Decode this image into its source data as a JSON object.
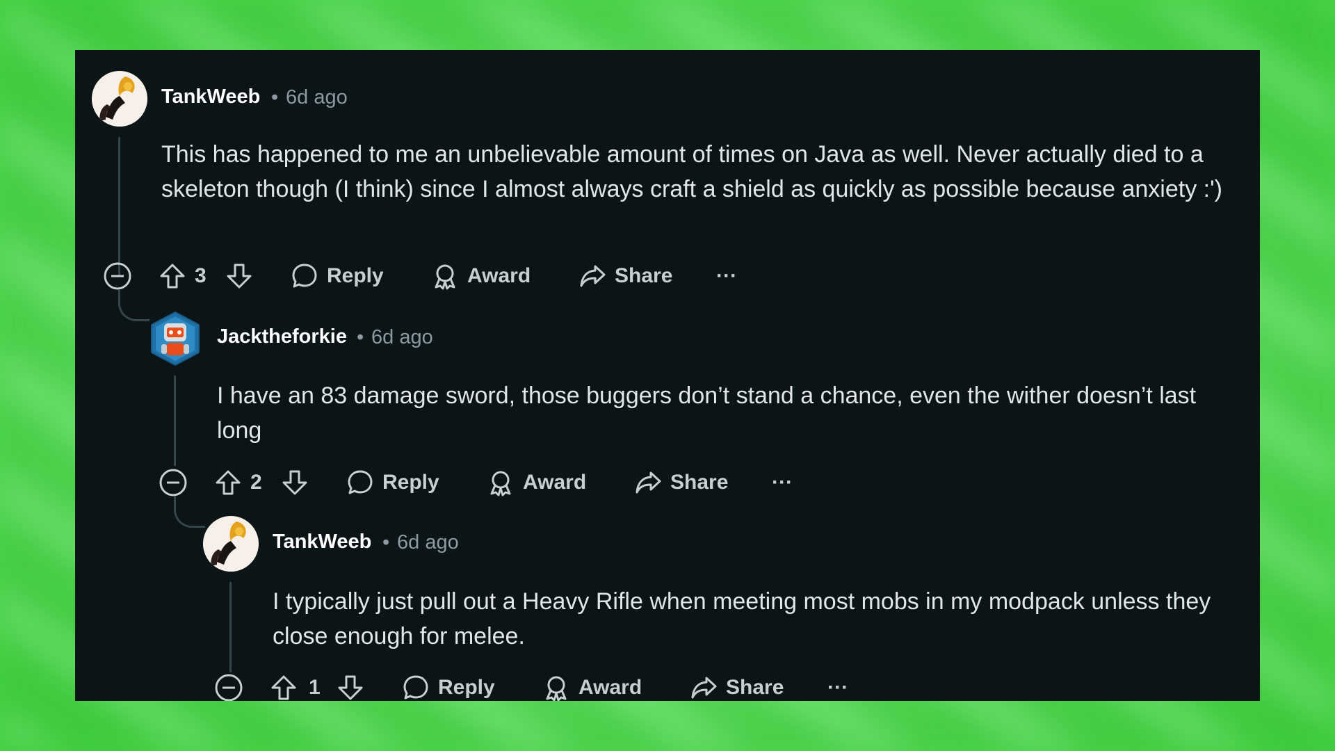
{
  "comments": [
    {
      "username": "TankWeeb",
      "separator": "•",
      "time": "6d ago",
      "text": "This has happened to me an unbelievable amount of times on Java as well. Never actually died to a skeleton though (I think) since I almost always craft a shield as quickly as possible because anxiety :')",
      "score": "3",
      "reply": "Reply",
      "award": "Award",
      "share": "Share",
      "more": "···"
    },
    {
      "username": "Jacktheforkie",
      "separator": "•",
      "time": "6d ago",
      "text": "I have an 83 damage sword, those buggers don’t stand a chance, even the wither doesn’t last long",
      "score": "2",
      "reply": "Reply",
      "award": "Award",
      "share": "Share",
      "more": "···"
    },
    {
      "username": "TankWeeb",
      "separator": "•",
      "time": "6d ago",
      "text": "I typically just pull out a Heavy Rifle when meeting most mobs in my modpack unless they close enough for melee.",
      "score": "1",
      "reply": "Reply",
      "award": "Award",
      "share": "Share",
      "more": "···"
    }
  ],
  "colors": {
    "panel_bg": "#0b1416",
    "background": "#6fe86f",
    "text": "#e2e6e8",
    "meta": "#8b9aa3",
    "thread_line": "#33464c"
  },
  "icons": [
    "collapse-icon",
    "upvote-icon",
    "downvote-icon",
    "comment-icon",
    "award-icon",
    "share-icon",
    "more-icon"
  ]
}
